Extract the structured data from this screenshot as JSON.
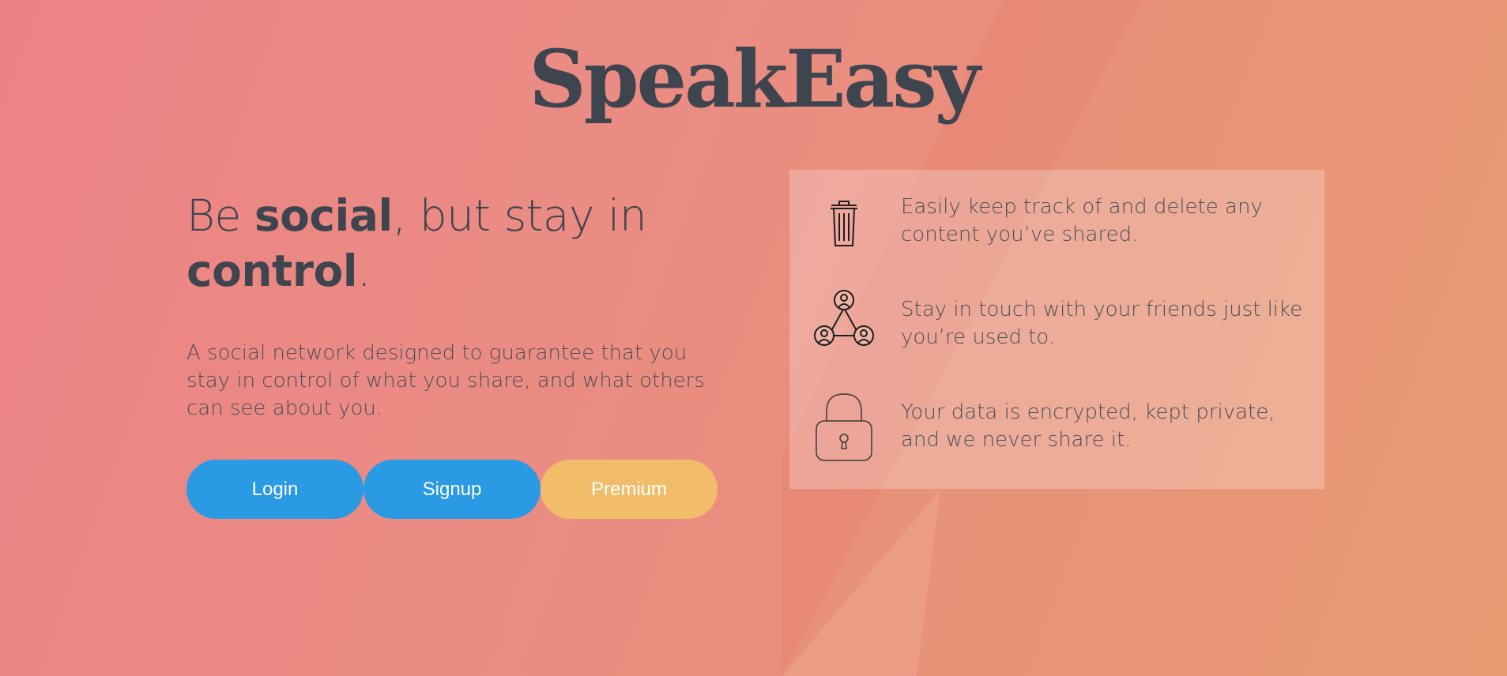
{
  "brand": {
    "name": "SpeakEasy"
  },
  "hero": {
    "headline_part1": "Be ",
    "headline_bold1": "social",
    "headline_part2": ", but stay in",
    "headline_bold2": "control",
    "headline_end": ".",
    "description": "A social network designed to guarantee that you stay in control of what you share, and what others can see about you."
  },
  "buttons": {
    "login": "Login",
    "signup": "Signup",
    "premium": "Premium"
  },
  "features": [
    {
      "icon": "trash-icon",
      "text": "Easily keep track of and delete any content you’ve shared."
    },
    {
      "icon": "network-icon",
      "text": "Stay in touch with your friends just like you’re used to."
    },
    {
      "icon": "lock-icon",
      "text": "Your data is encrypted, kept private, and we never share it."
    }
  ],
  "colors": {
    "button_primary": "#299ae3",
    "button_premium": "#f1bd6b",
    "text_dark": "#3f454f"
  }
}
